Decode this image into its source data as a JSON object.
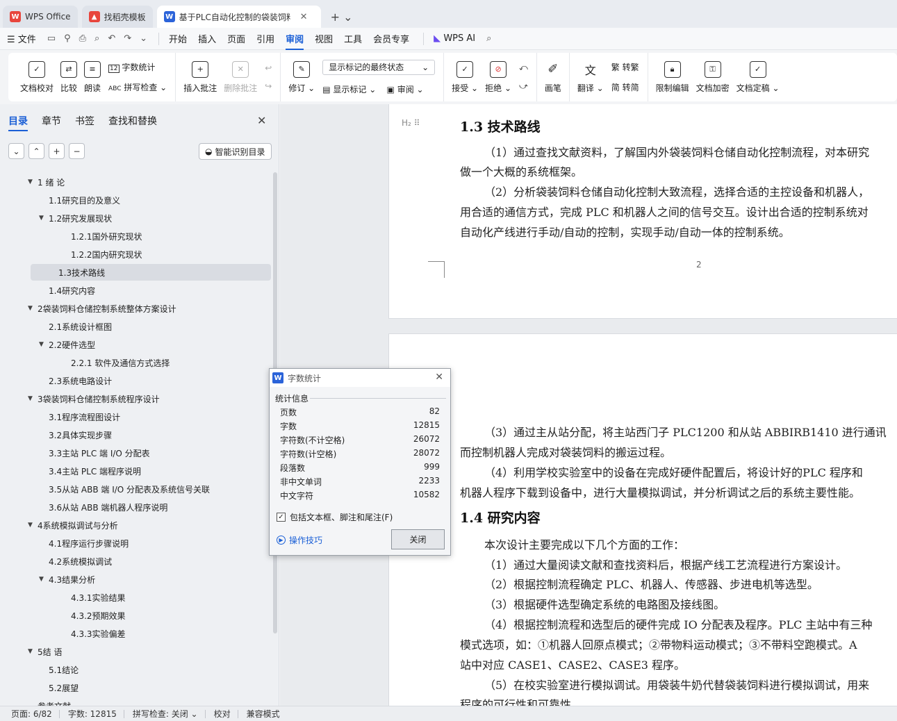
{
  "tabs": [
    {
      "label": "WPS Office",
      "icon": "wps-logo-icon",
      "color": "#e8453c"
    },
    {
      "label": "找稻壳模板",
      "icon": "docer-icon",
      "color": "#e8453c"
    },
    {
      "label": "基于PLC自动化控制的袋装饲料",
      "icon": "word-doc-icon",
      "color": "#2b63d9",
      "active": true
    }
  ],
  "tab_add": "+ ⌄",
  "menu": {
    "file": "文件",
    "items": [
      "开始",
      "插入",
      "页面",
      "引用",
      "审阅",
      "视图",
      "工具",
      "会员专享"
    ],
    "active": "审阅",
    "ai": "WPS AI"
  },
  "ribbon": {
    "doc_check": "文档校对",
    "compare": "比较",
    "read_aloud": "朗读",
    "word_count": "字数统计",
    "spell_check": "拼写检查",
    "insert_comment": "插入批注",
    "delete_comment": "删除批注",
    "revise": "修订",
    "markup_state": "显示标记的最终状态",
    "show_markup": "显示标记",
    "review": "审阅",
    "accept": "接受",
    "reject": "拒绝",
    "pen": "画笔",
    "translate": "翻译",
    "to_traditional": "转繁",
    "to_simplified": "转简",
    "restrict_edit": "限制编辑",
    "encrypt": "文档加密",
    "finalize": "文档定稿"
  },
  "nav": {
    "tabs": [
      "目录",
      "章节",
      "书签",
      "查找和替换"
    ],
    "active_tab": "目录",
    "controls": [
      "⌄",
      "⌃",
      "+",
      "−"
    ],
    "smart_toc": "智能识别目录",
    "toc": [
      {
        "label": "1 绪 论",
        "level": 1,
        "caret": true
      },
      {
        "label": "1.1研究目的及意义",
        "level": 2
      },
      {
        "label": "1.2研究发展现状",
        "level": 2,
        "caret": true
      },
      {
        "label": "1.2.1国外研究现状",
        "level": 3
      },
      {
        "label": "1.2.2国内研究现状",
        "level": 3
      },
      {
        "label": "1.3技术路线",
        "level": 2,
        "selected": true
      },
      {
        "label": "1.4研究内容",
        "level": 2
      },
      {
        "label": "2袋装饲料仓储控制系统整体方案设计",
        "level": 1,
        "caret": true
      },
      {
        "label": "2.1系统设计框图",
        "level": 2
      },
      {
        "label": "2.2硬件选型",
        "level": 2,
        "caret": true
      },
      {
        "label": "2.2.1 软件及通信方式选择",
        "level": 3
      },
      {
        "label": "2.3系统电路设计",
        "level": 2
      },
      {
        "label": "3袋装饲料仓储控制系统程序设计",
        "level": 1,
        "caret": true
      },
      {
        "label": "3.1程序流程图设计",
        "level": 2
      },
      {
        "label": "3.2具体实现步骤",
        "level": 2
      },
      {
        "label": "3.3主站 PLC 端 I/O 分配表",
        "level": 2
      },
      {
        "label": "3.4主站 PLC 端程序说明",
        "level": 2
      },
      {
        "label": "3.5从站 ABB 端 I/O 分配表及系统信号关联",
        "level": 2
      },
      {
        "label": "3.6从站 ABB 端机器人程序说明",
        "level": 2
      },
      {
        "label": "4系统模拟调试与分析",
        "level": 1,
        "caret": true
      },
      {
        "label": "4.1程序运行步骤说明",
        "level": 2
      },
      {
        "label": "4.2系统模拟调试",
        "level": 2
      },
      {
        "label": "4.3结果分析",
        "level": 2,
        "caret": true
      },
      {
        "label": "4.3.1实验结果",
        "level": 3
      },
      {
        "label": "4.3.2预期效果",
        "level": 3
      },
      {
        "label": "4.3.3实验偏差",
        "level": 3
      },
      {
        "label": "5结 语",
        "level": 1,
        "caret": true
      },
      {
        "label": "5.1结论",
        "level": 2
      },
      {
        "label": "5.2展望",
        "level": 2
      },
      {
        "label": "参考文献",
        "level": 1
      }
    ]
  },
  "doc": {
    "heading1": "1.3  技术路线",
    "p1_lines": [
      "（1）通过查找文献资料，了解国内外袋装饲料仓储自动化控制流程，对本研究",
      "做一个大概的系统框架。",
      "（2）分析袋装饲料仓储自动化控制大致流程，选择合适的主控设备和机器人，",
      "用合适的通信方式，完成 PLC 和机器人之间的信号交互。设计出合适的控制系统对",
      "自动化产线进行手动/自动的控制，实现手动/自动一体的控制系统。"
    ],
    "page_number": "2",
    "p2_lines": [
      "（3）通过主从站分配，将主站西门子 PLC1200 和从站 ABBIRB1410 进行通讯",
      "而控制机器人完成对袋装饲料的搬运过程。",
      "（4）利用学校实验室中的设备在完成好硬件配置后，将设计好的PLC 程序和",
      "机器人程序下载到设备中，进行大量模拟调试，并分析调试之后的系统主要性能。"
    ],
    "heading2": "1.4  研究内容",
    "p3_lines": [
      "本次设计主要完成以下几个方面的工作：",
      "（1）通过大量阅读文献和查找资料后，根据产线工艺流程进行方案设计。",
      "（2）根据控制流程确定 PLC、机器人、传感器、步进电机等选型。",
      "（3）根据硬件选型确定系统的电路图及接线图。",
      "（4）根据控制流程和选型后的硬件完成 IO 分配表及程序。PLC 主站中有三种",
      "模式选项，如：①机器人回原点模式；②带物料运动模式；③不带料空跑模式。A",
      "站中对应 CASE1、CASE2、CASE3 程序。",
      "（5）在校实验室进行模拟调试。用袋装牛奶代替袋装饲料进行模拟调试，用来",
      "程序的可行性和可靠性。"
    ]
  },
  "dialog": {
    "title": "字数统计",
    "section": "统计信息",
    "stats": [
      {
        "label": "页数",
        "value": "82"
      },
      {
        "label": "字数",
        "value": "12815"
      },
      {
        "label": "字符数(不计空格)",
        "value": "26072"
      },
      {
        "label": "字符数(计空格)",
        "value": "28072"
      },
      {
        "label": "段落数",
        "value": "999"
      },
      {
        "label": "非中文单词",
        "value": "2233"
      },
      {
        "label": "中文字符",
        "value": "10582"
      }
    ],
    "include_label": "包括文本框、脚注和尾注(F)",
    "include_checked": true,
    "tips": "操作技巧",
    "close": "关闭"
  },
  "status": {
    "page": "页面: 6/82",
    "words": "字数: 12815",
    "spell": "拼写检查: 关闭",
    "proof": "校对",
    "compat": "兼容模式"
  }
}
